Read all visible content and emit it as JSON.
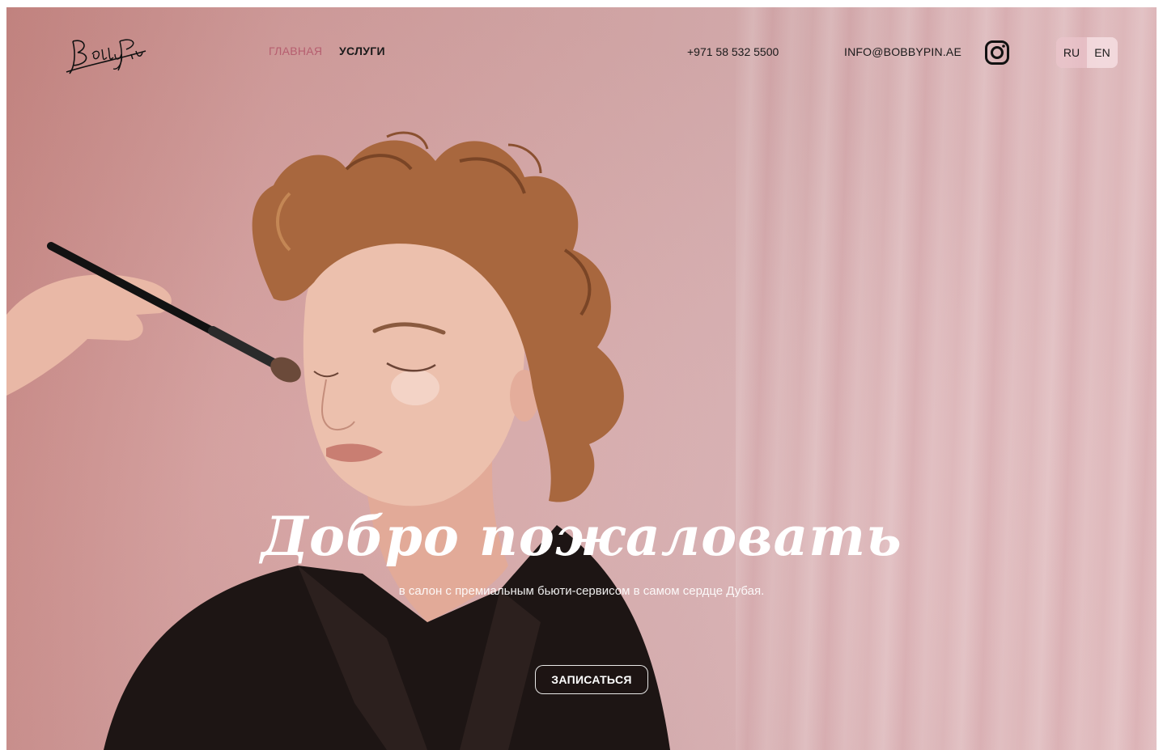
{
  "header": {
    "logo_alt": "Bobby Pin",
    "nav": [
      {
        "label": "ГЛАВНАЯ",
        "active": true
      },
      {
        "label": "УСЛУГИ",
        "active": false
      }
    ],
    "phone": "+971 58 532 5500",
    "email": "INFO@BOBBYPIN.AE",
    "social_icon": "instagram-icon",
    "languages": [
      {
        "label": "RU",
        "active": true
      },
      {
        "label": "EN",
        "active": false
      }
    ]
  },
  "hero": {
    "title": "Добро пожаловать",
    "subtitle": "в салон с премиальным бьюти-сервисом в самом сердце Дубая.",
    "cta_label": "ЗАПИСАТЬСЯ"
  },
  "colors": {
    "accent_pink": "#b65e6f",
    "text_dark": "#1a1a1a",
    "background_pink": "#d9aeae"
  }
}
